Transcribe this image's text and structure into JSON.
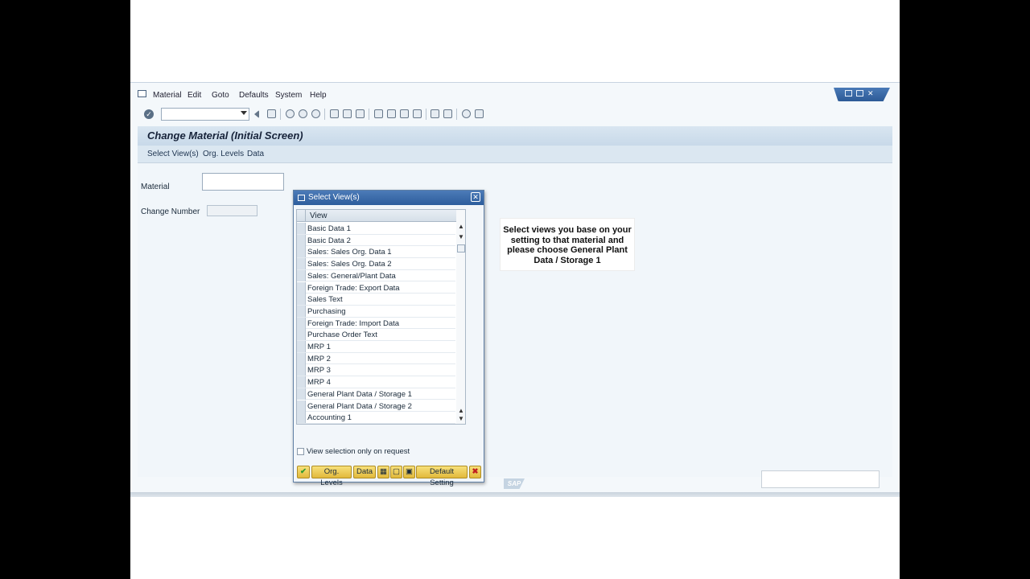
{
  "menu": {
    "items": [
      {
        "label": "Material"
      },
      {
        "label": "Edit"
      },
      {
        "label": "Goto"
      },
      {
        "label": "Defaults"
      },
      {
        "label": "System"
      },
      {
        "label": "Help"
      }
    ]
  },
  "toolbar": {
    "command_field_value": ""
  },
  "screen": {
    "title": "Change Material (Initial Screen)",
    "app_toolbar": [
      "Select View(s)",
      "Org. Levels",
      "Data"
    ]
  },
  "form": {
    "material_label": "Material",
    "material_value": "",
    "change_number_label": "Change Number",
    "change_number_value": ""
  },
  "dialog": {
    "title": "Select View(s)",
    "column_header": "View",
    "views": [
      "Basic Data 1",
      "Basic Data 2",
      "Sales: Sales Org. Data 1",
      "Sales: Sales Org. Data 2",
      "Sales: General/Plant Data",
      "Foreign Trade: Export Data",
      "Sales Text",
      "Purchasing",
      "Foreign Trade: Import Data",
      "Purchase Order Text",
      "MRP 1",
      "MRP 2",
      "MRP 3",
      "MRP 4",
      "General Plant Data / Storage 1",
      "General Plant Data / Storage 2",
      "Accounting 1"
    ],
    "view_selection_checkbox": "View selection only on request",
    "buttons": {
      "org_levels": "Org. Levels",
      "data": "Data",
      "default_setting": "Default Setting"
    }
  },
  "callout": {
    "text": "Select views you base on your setting to that material and please choose General Plant Data / Storage 1"
  },
  "logo": "SAP",
  "colors": {
    "title_blue": "#2d5d9c",
    "button_yellow": "#e2b93b",
    "ok_green": "#2f9a2f",
    "cancel_red": "#c02020"
  }
}
